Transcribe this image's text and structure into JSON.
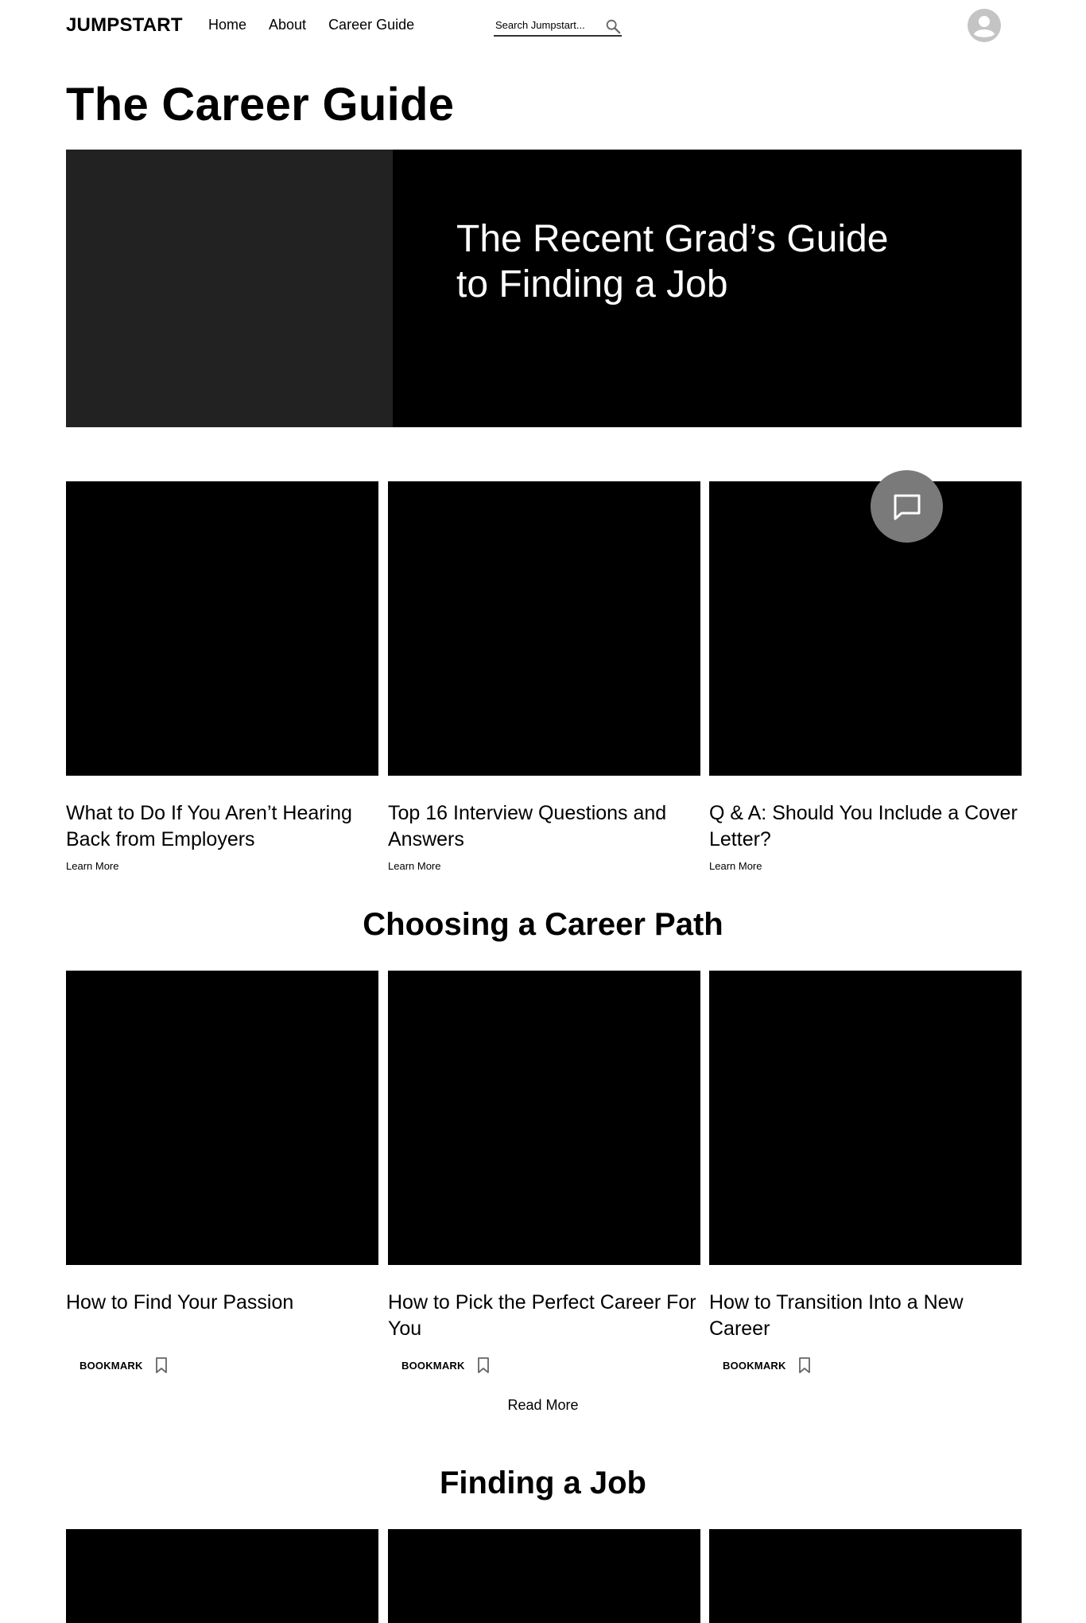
{
  "header": {
    "logo": "JUMPSTART",
    "nav": [
      "Home",
      "About",
      "Career Guide"
    ],
    "search_placeholder": "Search Jumpstart..."
  },
  "page_title": "The Career Guide",
  "hero": {
    "title": "The Recent Grad’s Guide to Finding a Job"
  },
  "featured": {
    "cards": [
      {
        "title": "What to Do If You Aren’t Hearing Back from Employers",
        "link": "Learn More"
      },
      {
        "title": "Top 16 Interview Questions and Answers",
        "link": "Learn More"
      },
      {
        "title": "Q & A: Should You Include a Cover Letter?",
        "link": "Learn More"
      }
    ]
  },
  "career_path": {
    "heading": "Choosing a Career Path",
    "cards": [
      {
        "title": "How to Find Your Passion",
        "bookmark": "BOOKMARK"
      },
      {
        "title": "How to Pick the Perfect Career For You",
        "bookmark": "BOOKMARK"
      },
      {
        "title": "How to Transition Into a New Career",
        "bookmark": "BOOKMARK"
      }
    ],
    "read_more": "Read More"
  },
  "finding_job": {
    "heading": "Finding a Job"
  },
  "icons": {
    "search": "search-icon",
    "avatar": "user-avatar-icon",
    "chat": "chat-icon",
    "bookmark": "bookmark-icon"
  },
  "colors": {
    "hero_bg": "#000000",
    "hero_image": "#222222",
    "chat_fab": "#7a7a7a",
    "avatar": "#c4c4c4"
  }
}
